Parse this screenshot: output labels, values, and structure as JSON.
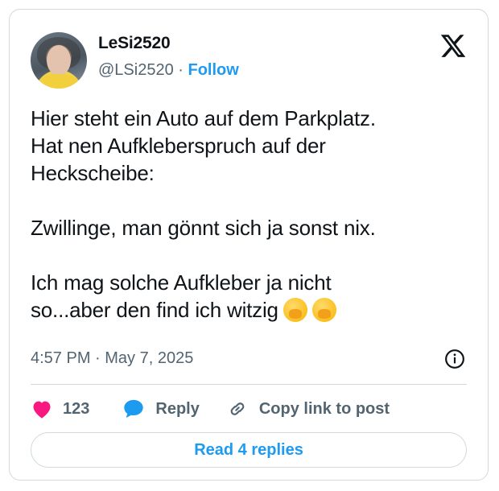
{
  "user": {
    "display_name": "LeSi2520",
    "handle": "@LSi2520",
    "separator": "·",
    "follow_label": "Follow"
  },
  "tweet": {
    "text": "Hier steht ein Auto auf dem Parkplatz.\nHat nen Aufkleberspruch auf der\nHeckscheibe:\n\nZwillinge, man gönnt sich ja sonst nix.\n\nIch mag solche Aufkleber ja nicht\nso...aber den find ich witzig",
    "emojis": [
      "face-with-hand-over-mouth-icon",
      "face-with-hand-over-mouth-icon"
    ],
    "timestamp": "4:57 PM · May 7, 2025"
  },
  "actions": {
    "like_count": "123",
    "reply_label": "Reply",
    "copy_link_label": "Copy link to post"
  },
  "footer": {
    "read_replies_label": "Read 4 replies"
  },
  "colors": {
    "accent": "#1d9bf0",
    "like": "#f91880",
    "muted": "#536471",
    "border": "#cfd9de"
  }
}
